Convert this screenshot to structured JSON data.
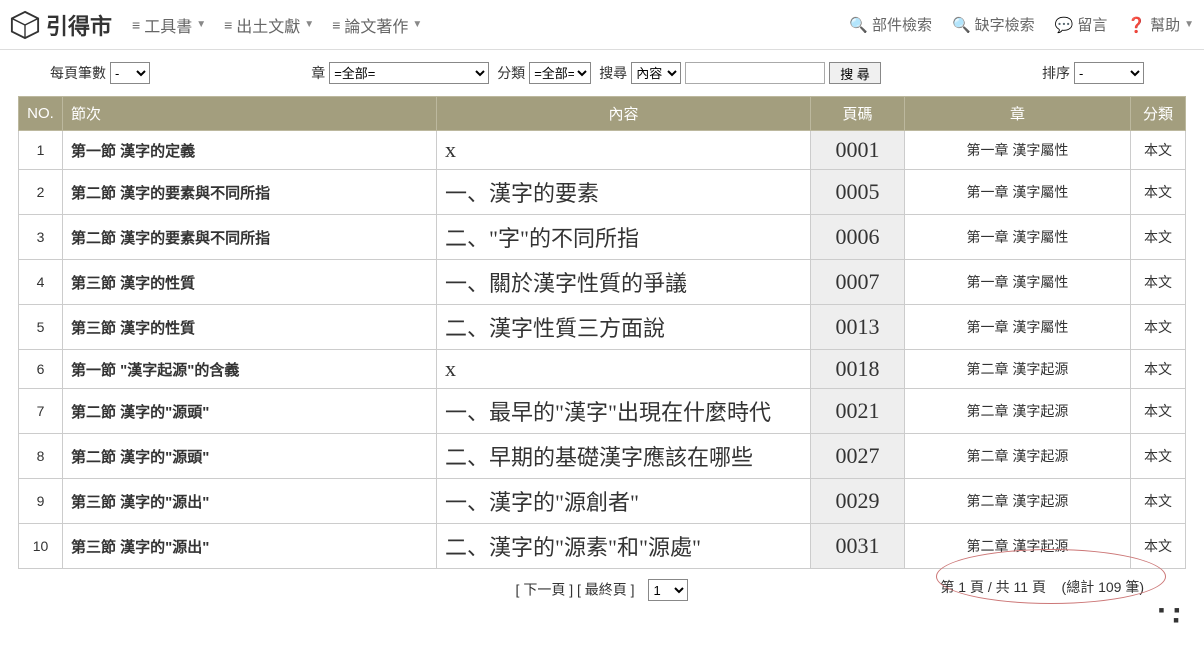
{
  "logo_text": "引得市",
  "nav": {
    "tools": "工具書",
    "unearthed": "出土文獻",
    "papers": "論文著作",
    "part_search": "部件檢索",
    "missing_search": "缺字檢索",
    "message": "留言",
    "help": "幫助"
  },
  "filters": {
    "per_page_label": "每頁筆數",
    "per_page_value": "-",
    "chapter_label": "章",
    "chapter_value": "=全部=",
    "category_label": "分類",
    "category_value": "=全部=",
    "search_label": "搜尋",
    "search_field": "內容",
    "search_btn": "搜 尋",
    "sort_label": "排序",
    "sort_value": "-"
  },
  "headers": {
    "no": "NO.",
    "section": "節次",
    "content": "內容",
    "page": "頁碼",
    "chapter": "章",
    "category": "分類"
  },
  "rows": [
    {
      "no": "1",
      "section": "第一節 漢字的定義",
      "content": "x",
      "page": "0001",
      "chapter": "第一章 漢字屬性",
      "cat": "本文"
    },
    {
      "no": "2",
      "section": "第二節 漢字的要素與不同所指",
      "content": "一、漢字的要素",
      "page": "0005",
      "chapter": "第一章 漢字屬性",
      "cat": "本文"
    },
    {
      "no": "3",
      "section": "第二節 漢字的要素與不同所指",
      "content": "二、\"字\"的不同所指",
      "page": "0006",
      "chapter": "第一章 漢字屬性",
      "cat": "本文"
    },
    {
      "no": "4",
      "section": "第三節 漢字的性質",
      "content": "一、關於漢字性質的爭議",
      "page": "0007",
      "chapter": "第一章 漢字屬性",
      "cat": "本文"
    },
    {
      "no": "5",
      "section": "第三節 漢字的性質",
      "content": "二、漢字性質三方面說",
      "page": "0013",
      "chapter": "第一章 漢字屬性",
      "cat": "本文"
    },
    {
      "no": "6",
      "section": "第一節 \"漢字起源\"的含義",
      "content": "x",
      "page": "0018",
      "chapter": "第二章 漢字起源",
      "cat": "本文"
    },
    {
      "no": "7",
      "section": "第二節 漢字的\"源頭\"",
      "content": "一、最早的\"漢字\"出現在什麼時代",
      "page": "0021",
      "chapter": "第二章 漢字起源",
      "cat": "本文"
    },
    {
      "no": "8",
      "section": "第二節 漢字的\"源頭\"",
      "content": "二、早期的基礎漢字應該在哪些",
      "page": "0027",
      "chapter": "第二章 漢字起源",
      "cat": "本文"
    },
    {
      "no": "9",
      "section": "第三節 漢字的\"源出\"",
      "content": "一、漢字的\"源創者\"",
      "page": "0029",
      "chapter": "第二章 漢字起源",
      "cat": "本文"
    },
    {
      "no": "10",
      "section": "第三節 漢字的\"源出\"",
      "content": "二、漢字的\"源素\"和\"源處\"",
      "page": "0031",
      "chapter": "第二章 漢字起源",
      "cat": "本文"
    }
  ],
  "pager": {
    "next": "[ 下一頁 ]",
    "last": "[ 最終頁 ]",
    "page_value": "1",
    "summary_prefix": "第 1 頁 / 共 11 頁",
    "summary_total": "(總計 109 筆)"
  }
}
